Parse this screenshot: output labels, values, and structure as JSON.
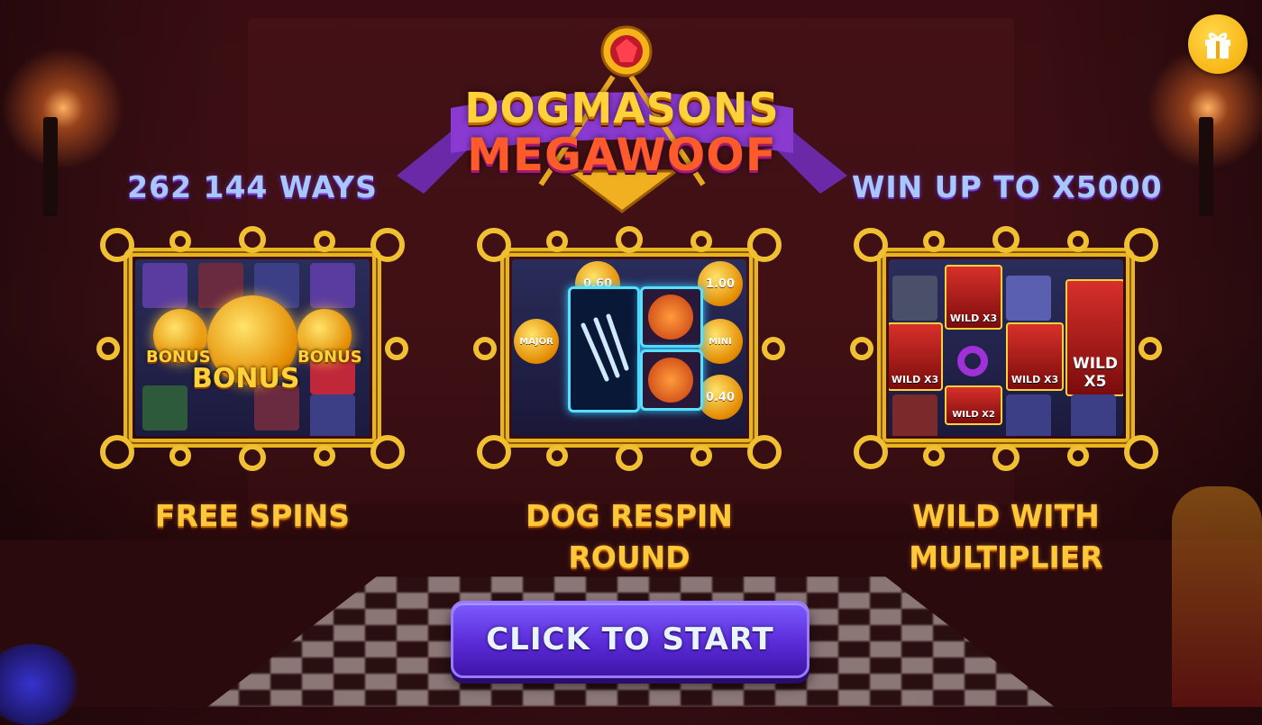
{
  "logo": {
    "line1": "DOGMASONS",
    "line2": "MEGAWOOF"
  },
  "headings": {
    "left": "262 144 WAYS",
    "right": "WIN UP TO X5000"
  },
  "features": [
    {
      "label_lines": [
        "FREE SPINS"
      ],
      "screen": {
        "bonus_main": "BONUS",
        "bonus_side": "BONUS"
      }
    },
    {
      "label_lines": [
        "DOG RESPIN",
        "ROUND"
      ],
      "screen": {
        "coins": [
          "0.60",
          "1.00",
          "0.40"
        ],
        "labels": [
          "MAJOR",
          "MINI"
        ]
      }
    },
    {
      "label_lines": [
        "WILD WITH",
        "MULTIPLIER"
      ],
      "screen": {
        "wilds": [
          "WILD X3",
          "WILD X3",
          "WILD X3",
          "WILD X5",
          "WILD X2"
        ]
      }
    }
  ],
  "start_button": "CLICK TO START",
  "colors": {
    "accent_gold": "#ffc83a",
    "button_purple": "#5a2bd8",
    "heading_blue": "#a6c8ff"
  },
  "icons": {
    "gift": "gift-icon",
    "gem": "gem-icon",
    "paw": "paw-icon"
  }
}
